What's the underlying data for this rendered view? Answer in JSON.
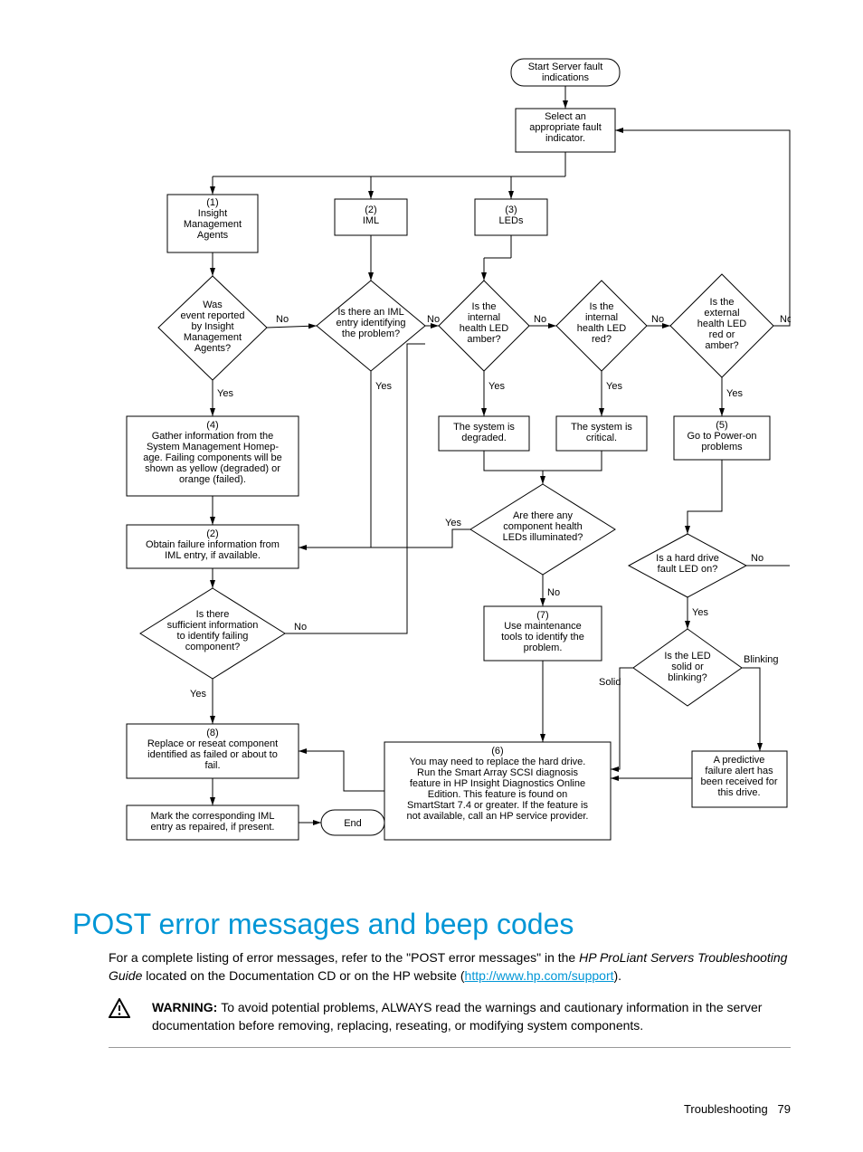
{
  "flowchart": {
    "start": "Start Server fault\nindications",
    "select": "Select an\nappropriate fault\nindicator.",
    "b1": "(1)\nInsight\nManagement\nAgents",
    "b2": "(2)\nIML",
    "b3": "(3)\nLEDs",
    "d_event": "Was\nevent reported\nby Insight\nManagement\nAgents?",
    "d_iml": "Is there an IML\nentry identifying\nthe problem?",
    "d_internal_amber": "Is the\ninternal\nhealth LED\namber?",
    "d_internal_red": "Is the\ninternal\nhealth LED\nred?",
    "d_external": "Is the\nexternal\nhealth LED\nred or\namber?",
    "b4": "(4)\nGather information from the\nSystem Management Homep-\nage. Failing components will be\nshown as yellow (degraded) or\norange (failed).",
    "b_degraded": "The system is\ndegraded.",
    "b_critical": "The system is\ncritical.",
    "b5": "(5)\nGo to Power-on\nproblems",
    "b2b": "(2)\nObtain failure information from\nIML entry, if available.",
    "d_comp": "Are there any\ncomponent health\nLEDs illuminated?",
    "d_hd": "Is a hard drive\nfault LED on?",
    "d_suff": "Is there\nsufficient information\nto identify failing\ncomponent?",
    "b7": "(7)\nUse maintenance\ntools to identify the\nproblem.",
    "d_blink": "Is the LED\nsolid or\nblinking?",
    "b8": "(8)\nReplace or reseat component\nidentified as failed or about to\nfail.",
    "b6": "(6)\nYou may need to replace the hard drive.\nRun the Smart Array SCSI diagnosis\nfeature in HP Insight Diagnostics Online\nEdition. This feature is found on\nSmartStart 7.4 or greater. If the feature is\nnot available, call an HP service provider.",
    "b_pred": "A predictive\nfailure alert has\nbeen received for\nthis drive.",
    "b_mark": "Mark the corresponding IML\nentry as repaired, if present.",
    "end": "End",
    "yes": "Yes",
    "no": "No",
    "solid": "Solid",
    "blinking": "Blinking"
  },
  "heading": "POST error messages and beep codes",
  "para_pre": "For a complete listing of error messages, refer to the \"POST error messages\" in the",
  "para_italic": "HP ProLiant Servers Troubleshooting Guide",
  "para_post": "located on the Documentation CD or on the HP website",
  "link": "http://www.hp.com/support",
  "warning_label": "WARNING:",
  "warning_text": "To avoid potential problems, ALWAYS read the warnings and cautionary information in the server documentation before removing, replacing, reseating, or modifying system components.",
  "footer_section": "Troubleshooting",
  "footer_page": "79"
}
